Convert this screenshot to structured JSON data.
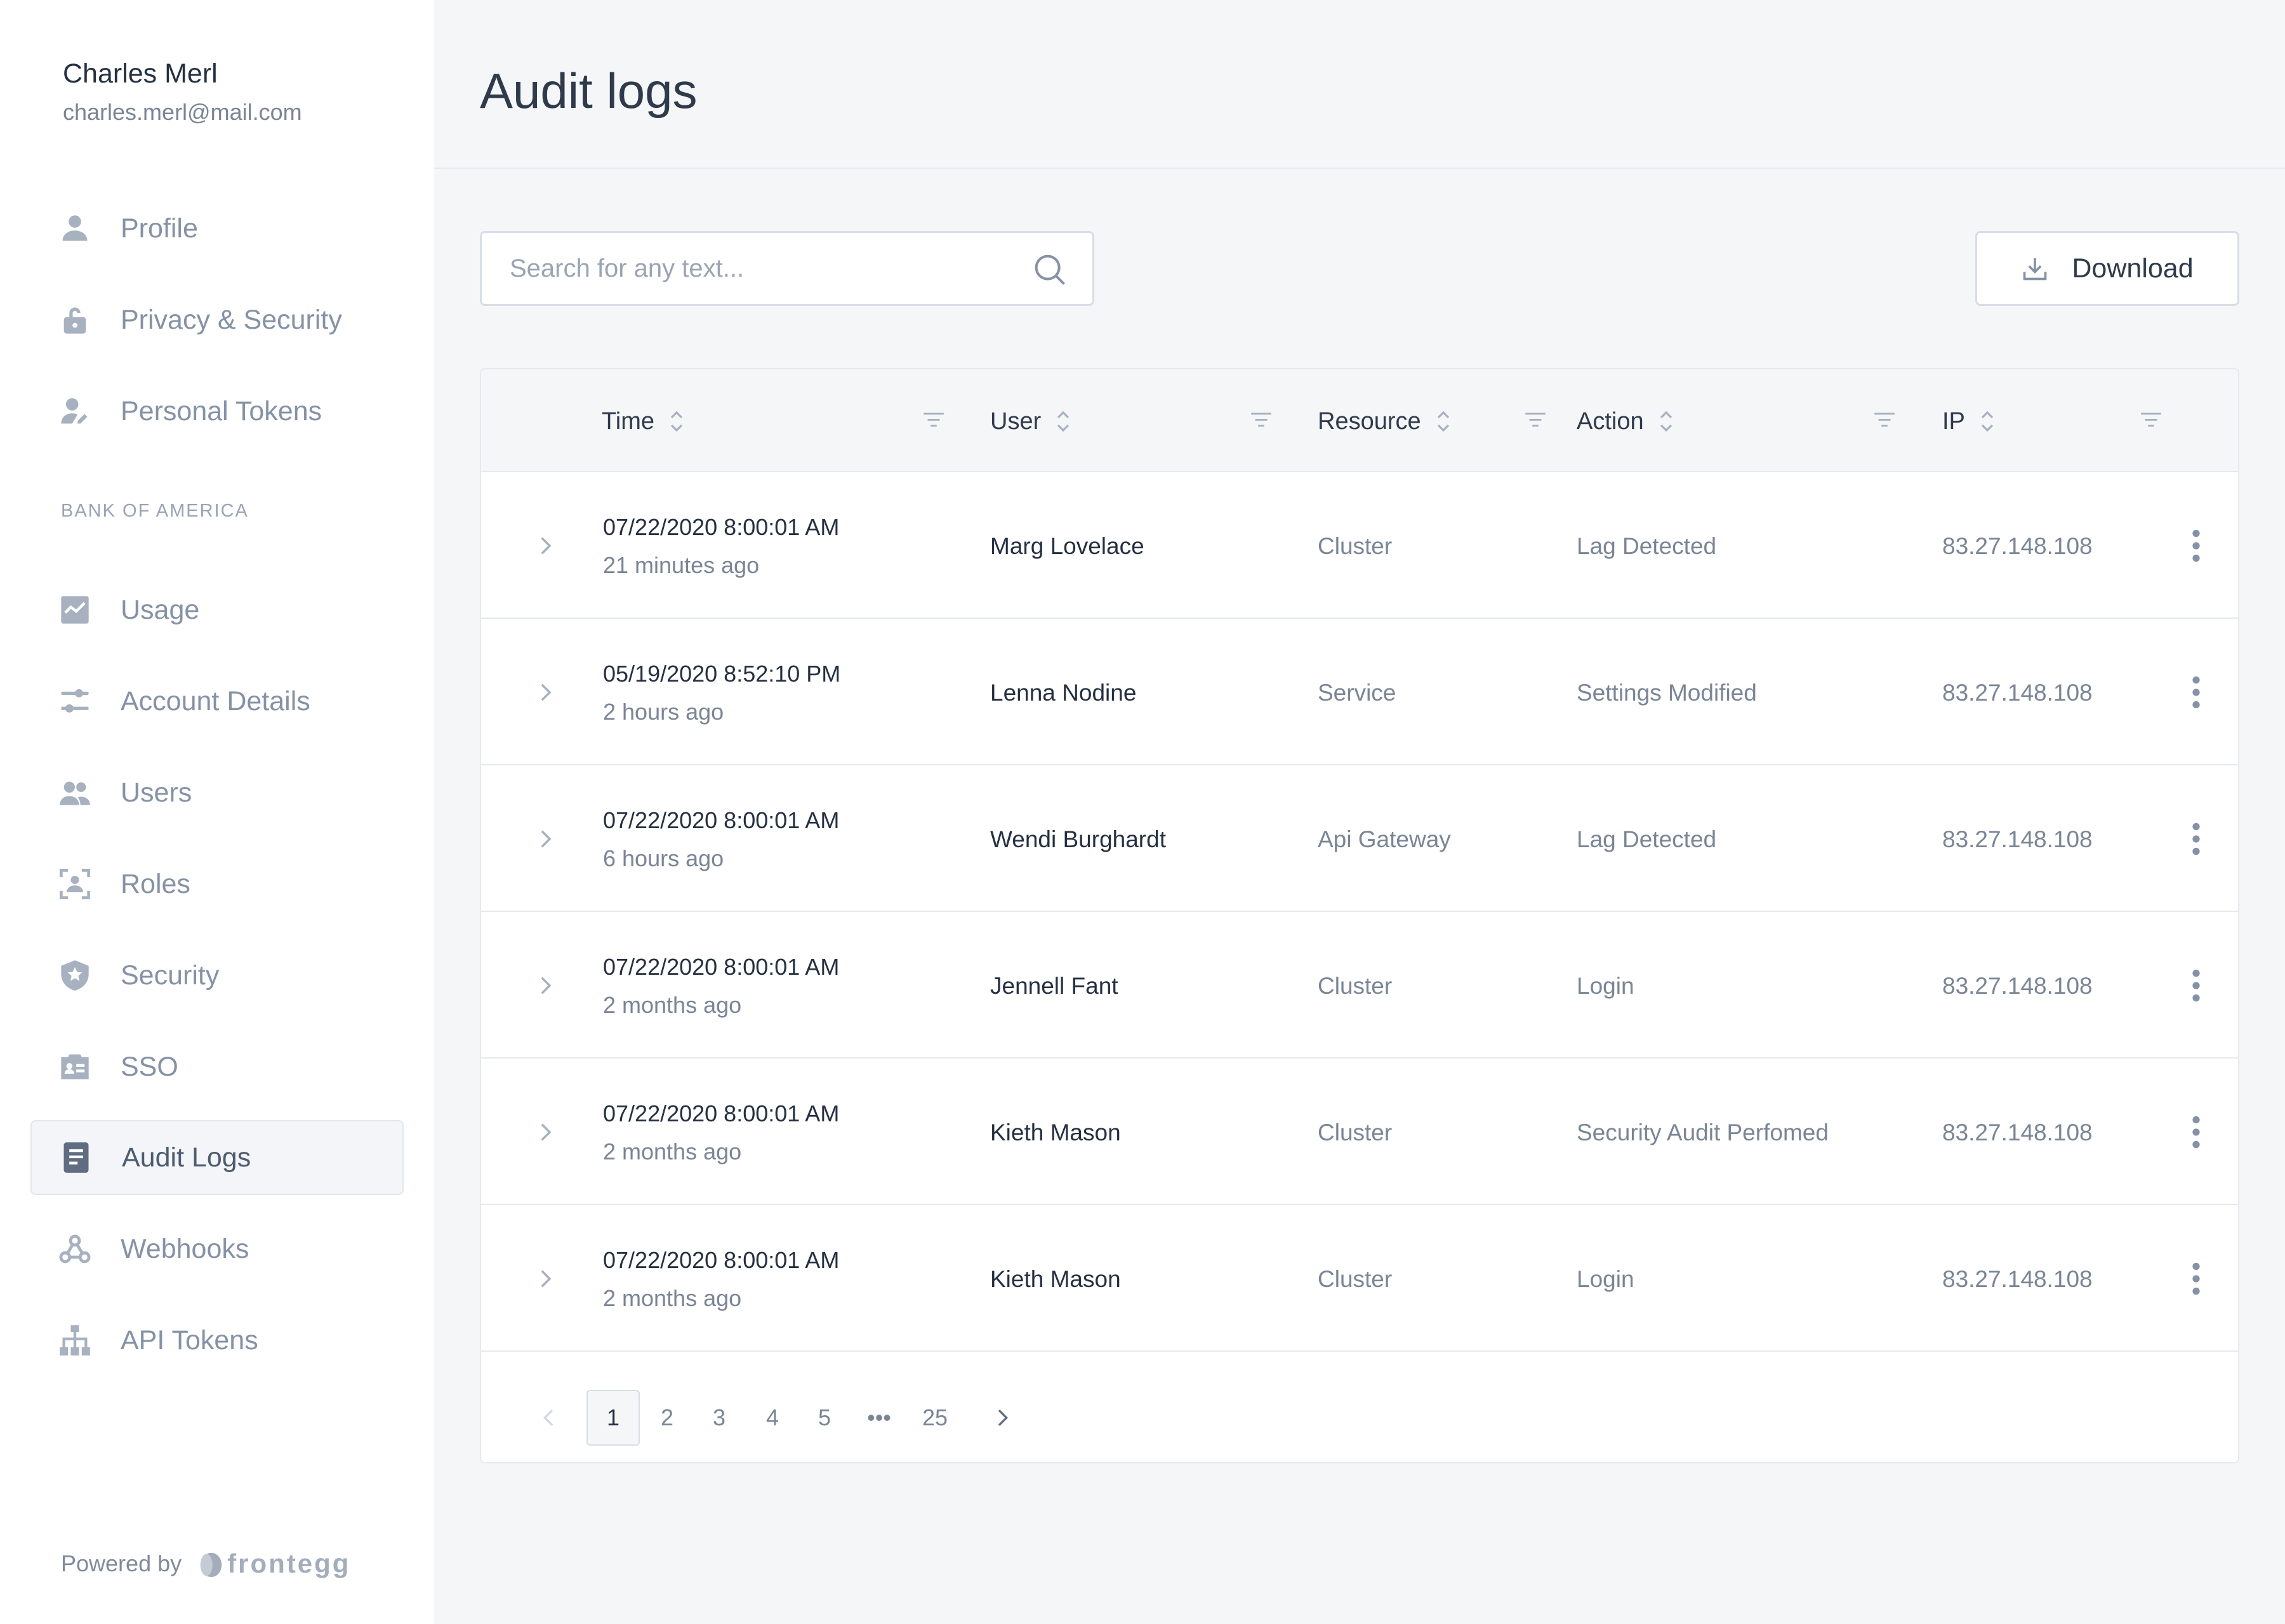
{
  "account": {
    "name": "Charles Merl",
    "email": "charles.merl@mail.com"
  },
  "nav_top": [
    {
      "label": "Profile",
      "icon": "user-icon"
    },
    {
      "label": "Privacy & Security",
      "icon": "lock-icon"
    },
    {
      "label": "Personal Tokens",
      "icon": "user-key-icon"
    }
  ],
  "org_section_title": "BANK OF AMERICA",
  "nav_org": [
    {
      "label": "Usage",
      "icon": "chart-icon"
    },
    {
      "label": "Account Details",
      "icon": "sliders-icon"
    },
    {
      "label": "Users",
      "icon": "users-icon"
    },
    {
      "label": "Roles",
      "icon": "roles-icon"
    },
    {
      "label": "Security",
      "icon": "shield-icon"
    },
    {
      "label": "SSO",
      "icon": "sso-icon"
    },
    {
      "label": "Audit Logs",
      "icon": "document-icon",
      "active": true
    },
    {
      "label": "Webhooks",
      "icon": "webhook-icon"
    },
    {
      "label": "API Tokens",
      "icon": "sitemap-icon"
    }
  ],
  "footer": {
    "powered_by": "Powered by",
    "brand": "frontegg"
  },
  "header": {
    "title": "Audit logs"
  },
  "toolbar": {
    "search_placeholder": "Search for any text...",
    "download_label": "Download"
  },
  "table": {
    "columns": [
      "Time",
      "User",
      "Resource",
      "Action",
      "IP"
    ],
    "rows": [
      {
        "time": "07/22/2020 8:00:01 AM",
        "ago": "21 minutes ago",
        "user": "Marg Lovelace",
        "resource": "Cluster",
        "action": "Lag Detected",
        "ip": "83.27.148.108"
      },
      {
        "time": "05/19/2020 8:52:10 PM",
        "ago": "2 hours ago",
        "user": "Lenna Nodine",
        "resource": "Service",
        "action": "Settings Modified",
        "ip": "83.27.148.108"
      },
      {
        "time": "07/22/2020 8:00:01 AM",
        "ago": "6 hours ago",
        "user": "Wendi Burghardt",
        "resource": "Api Gateway",
        "action": "Lag Detected",
        "ip": "83.27.148.108"
      },
      {
        "time": "07/22/2020 8:00:01 AM",
        "ago": "2 months ago",
        "user": "Jennell Fant",
        "resource": "Cluster",
        "action": "Login",
        "ip": "83.27.148.108"
      },
      {
        "time": "07/22/2020 8:00:01 AM",
        "ago": "2 months ago",
        "user": "Kieth Mason",
        "resource": "Cluster",
        "action": "Security Audit Perfomed",
        "ip": "83.27.148.108"
      },
      {
        "time": "07/22/2020 8:00:01 AM",
        "ago": "2 months ago",
        "user": "Kieth Mason",
        "resource": "Cluster",
        "action": "Login",
        "ip": "83.27.148.108"
      }
    ]
  },
  "pagination": {
    "pages": [
      "1",
      "2",
      "3",
      "4",
      "5"
    ],
    "ellipsis": "•••",
    "last": "25",
    "current": "1"
  },
  "colors": {
    "sidebar_bg": "#ffffff",
    "main_bg": "#f5f6f8",
    "icon": "#a7b1bf",
    "text_primary": "#253041",
    "text_secondary": "#7a8596"
  }
}
